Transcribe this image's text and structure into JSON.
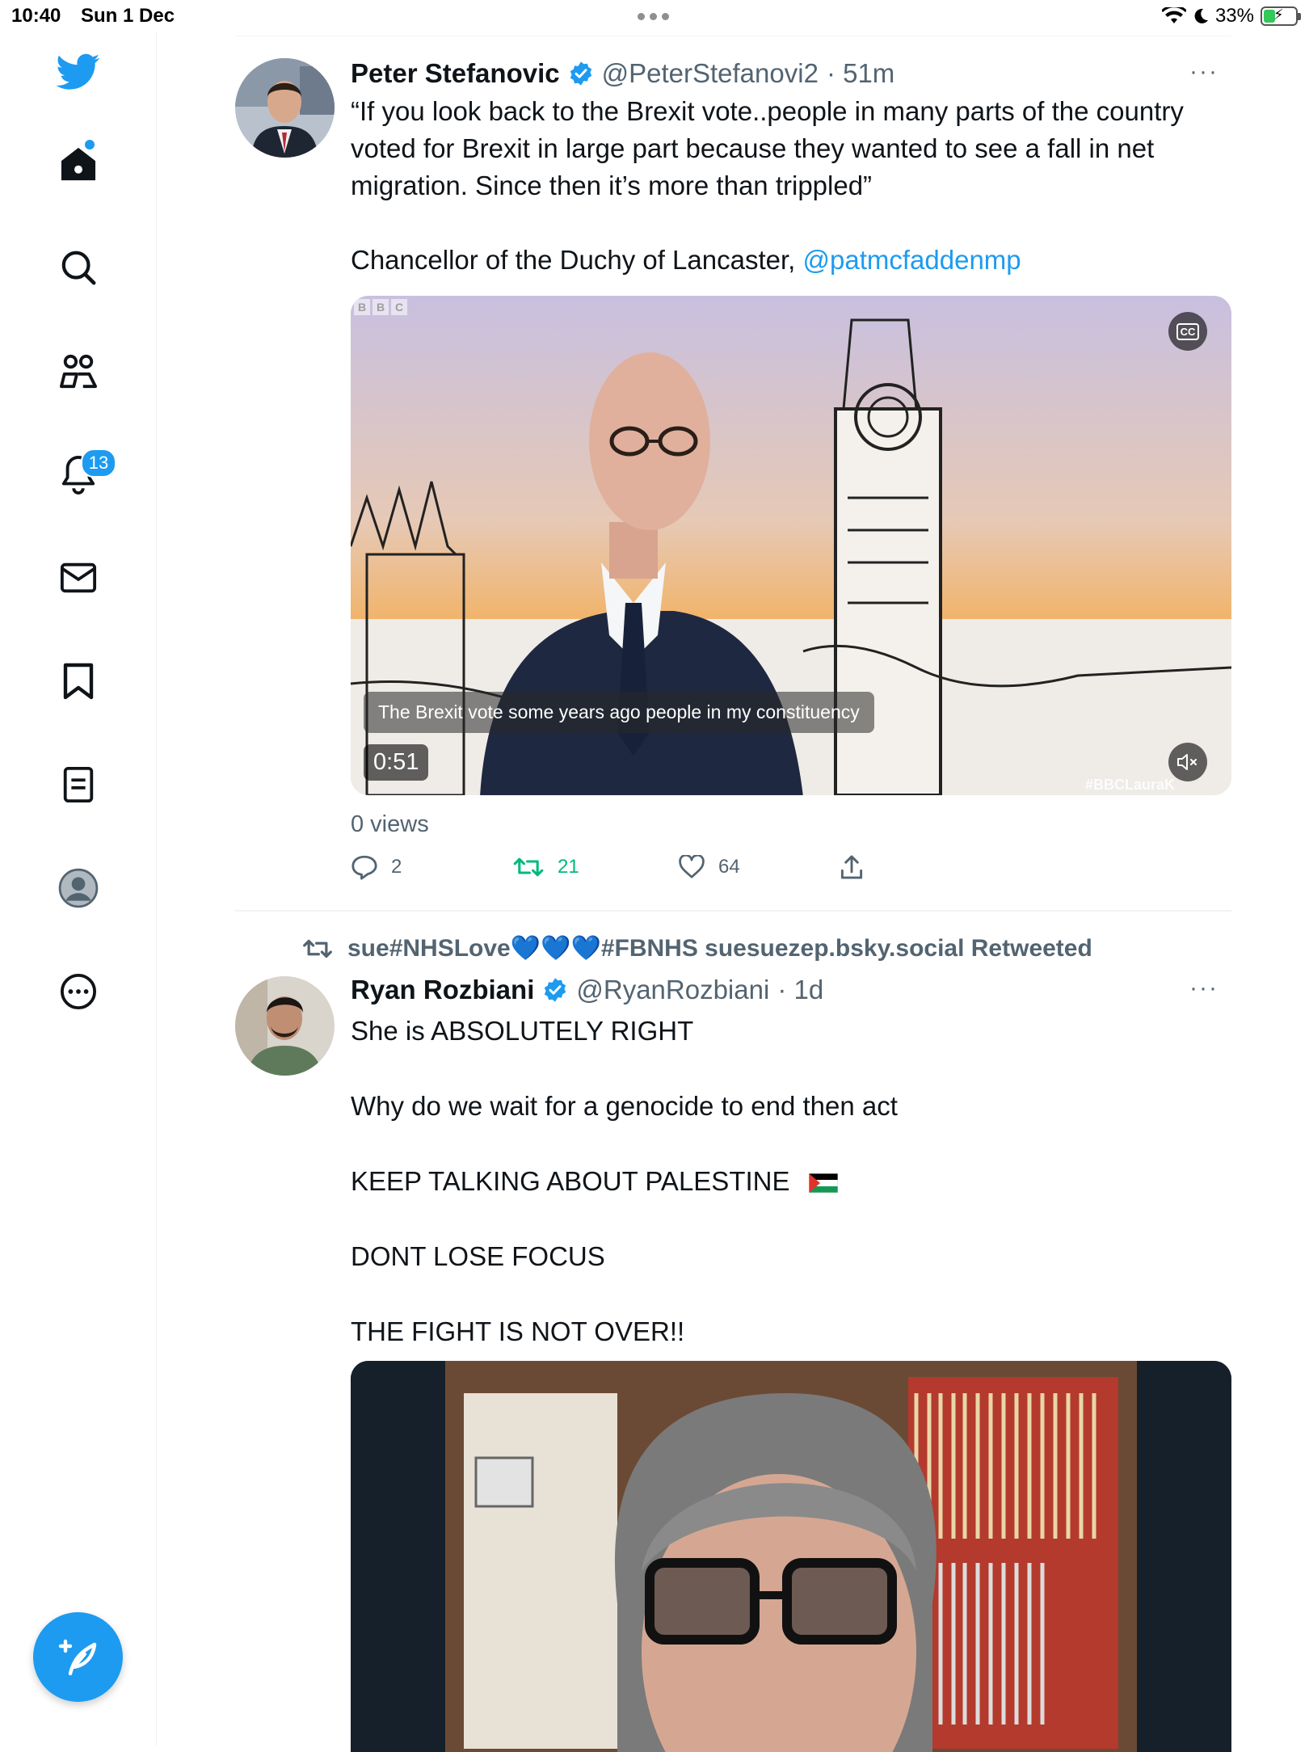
{
  "status_bar": {
    "time": "10:40",
    "date": "Sun 1 Dec",
    "battery": "33%"
  },
  "sidebar": {
    "items": [
      {
        "name": "twitter-logo-icon"
      },
      {
        "name": "home-icon"
      },
      {
        "name": "search-icon"
      },
      {
        "name": "communities-icon"
      },
      {
        "name": "notifications-icon",
        "badge": "13"
      },
      {
        "name": "messages-icon"
      },
      {
        "name": "bookmarks-icon"
      },
      {
        "name": "lists-icon"
      },
      {
        "name": "profile-icon"
      },
      {
        "name": "more-icon"
      }
    ],
    "compose_icon": "compose-tweet-icon"
  },
  "tweets": [
    {
      "name": "Peter Stefanovic",
      "handle": "@PeterStefanovi2",
      "time": "· 51m",
      "more": "···",
      "text": [
        "“If you look back to the Brexit vote..people in many parts of the country voted for Brexit in large part because they wanted to see a fall in net migration. Since then it’s more than trippled”",
        "Chancellor of the Duchy of Lancaster, "
      ],
      "mention": "@patmcfaddenmp",
      "video": {
        "caption": "The Brexit vote some years ago people in my constituency",
        "duration": "0:51",
        "cc_label": "CC",
        "watermark_logo": [
          "B",
          "B",
          "C"
        ],
        "watermark_tag": "#BBCLauraK"
      },
      "views": "0 views",
      "replies": "2",
      "retweets": "21",
      "likes": "64"
    },
    {
      "retweeted_by": "sue#NHSLove",
      "retweeted_tail": "#FBNHS suesuezep.bsky.social Retweeted",
      "hearts": "💙💙💙",
      "name": "Ryan Rozbiani",
      "handle": "@RyanRozbiani",
      "time": "· 1d",
      "more": "···",
      "lines": [
        "She is ABSOLUTELY RIGHT",
        "Why do we wait for a genocide to end then act",
        "KEEP TALKING ABOUT PALESTINE",
        "DONT LOSE FOCUS",
        "THE FIGHT IS NOT OVER!!"
      ]
    }
  ],
  "colors": {
    "accent": "#1d9bf0",
    "retweet_green": "#00ba7c",
    "text_primary": "#0f1419",
    "text_secondary": "#536471"
  }
}
